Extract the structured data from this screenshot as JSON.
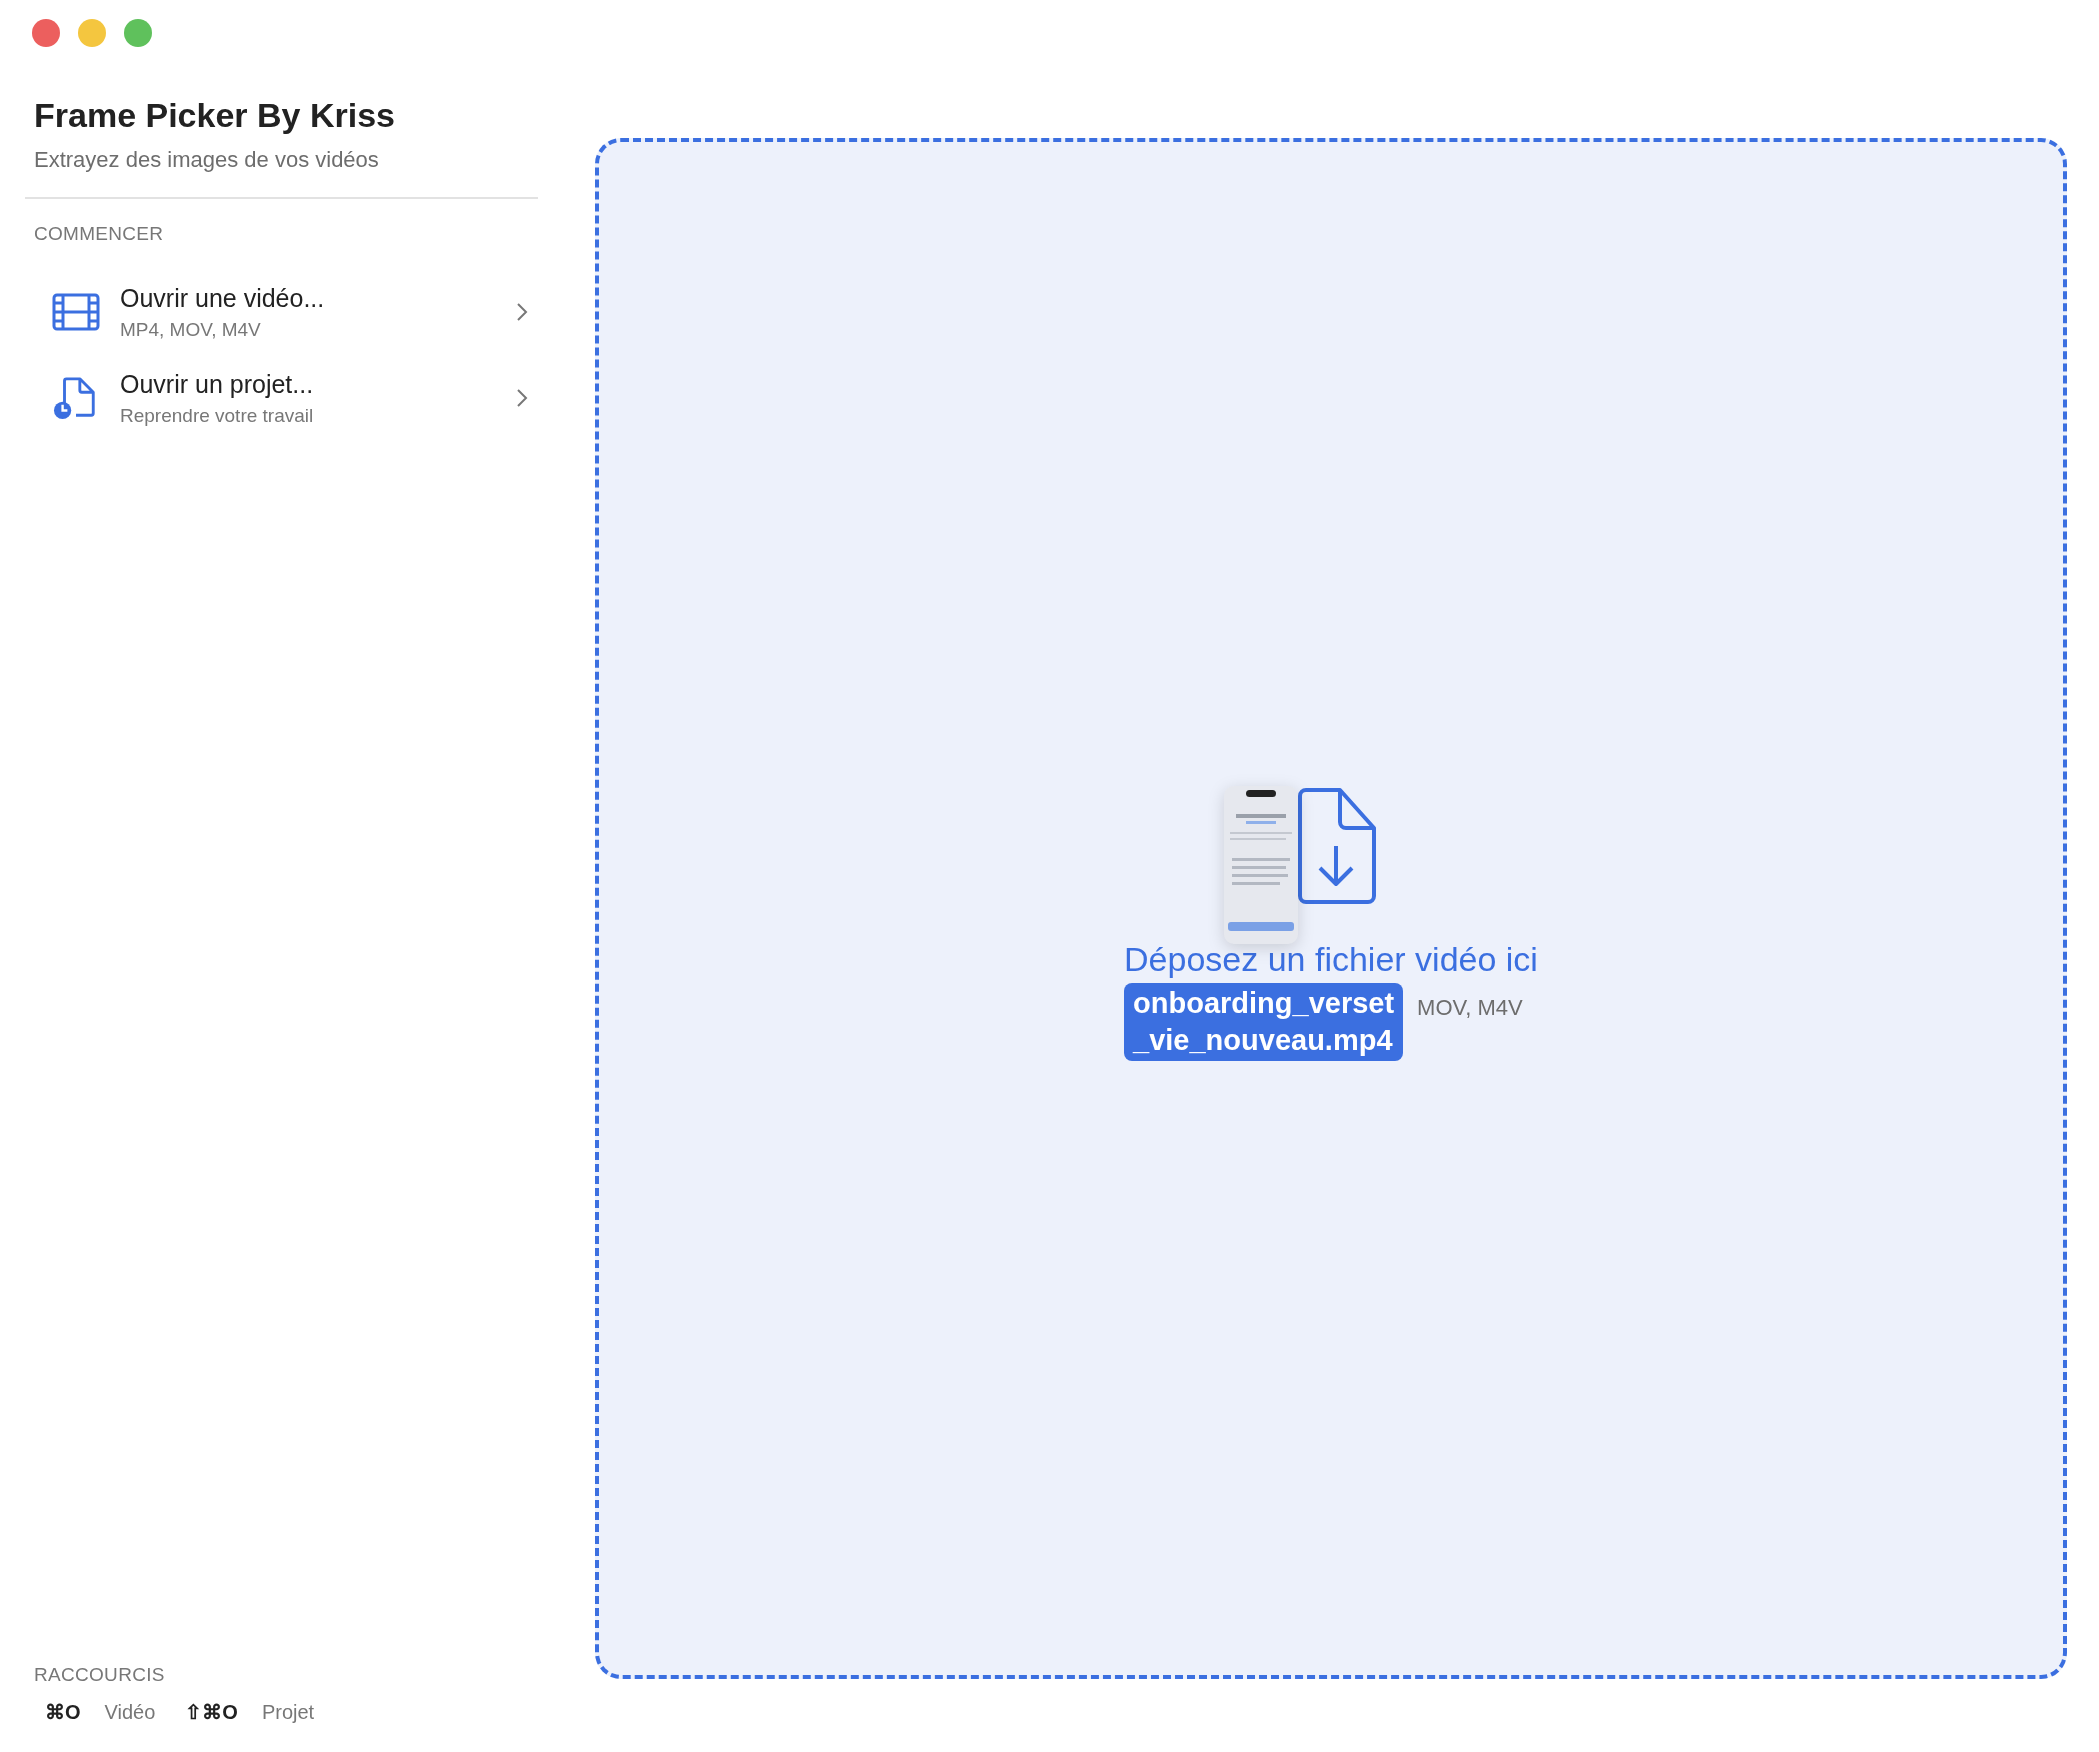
{
  "window": {
    "controls": [
      {
        "color": "#ec5f5e"
      },
      {
        "color": "#f4c63f"
      },
      {
        "color": "#5fc15c"
      }
    ]
  },
  "sidebar": {
    "title": "Frame Picker By Kriss",
    "subtitle": "Extrayez des images de vos vidéos",
    "section": "COMMENCER",
    "items": [
      {
        "kind": "video",
        "title": "Ouvrir une vidéo...",
        "subtitle": "MP4, MOV, M4V"
      },
      {
        "kind": "project",
        "title": "Ouvrir un projet...",
        "subtitle": "Reprendre votre travail"
      }
    ],
    "shortcuts_heading": "RACCOURCIS",
    "shortcuts": [
      {
        "keys": "⌘O",
        "label": "Vidéo"
      },
      {
        "keys": "⇧⌘O",
        "label": "Projet"
      }
    ]
  },
  "drop_zone": {
    "title": "Déposez un fichier vidéo ici",
    "subtitle_visible": "MOV, M4V",
    "drag_preview": {
      "kind": "picture",
      "file_name": "onboarding_verset\n_vie_nouveau.mp4"
    }
  }
}
